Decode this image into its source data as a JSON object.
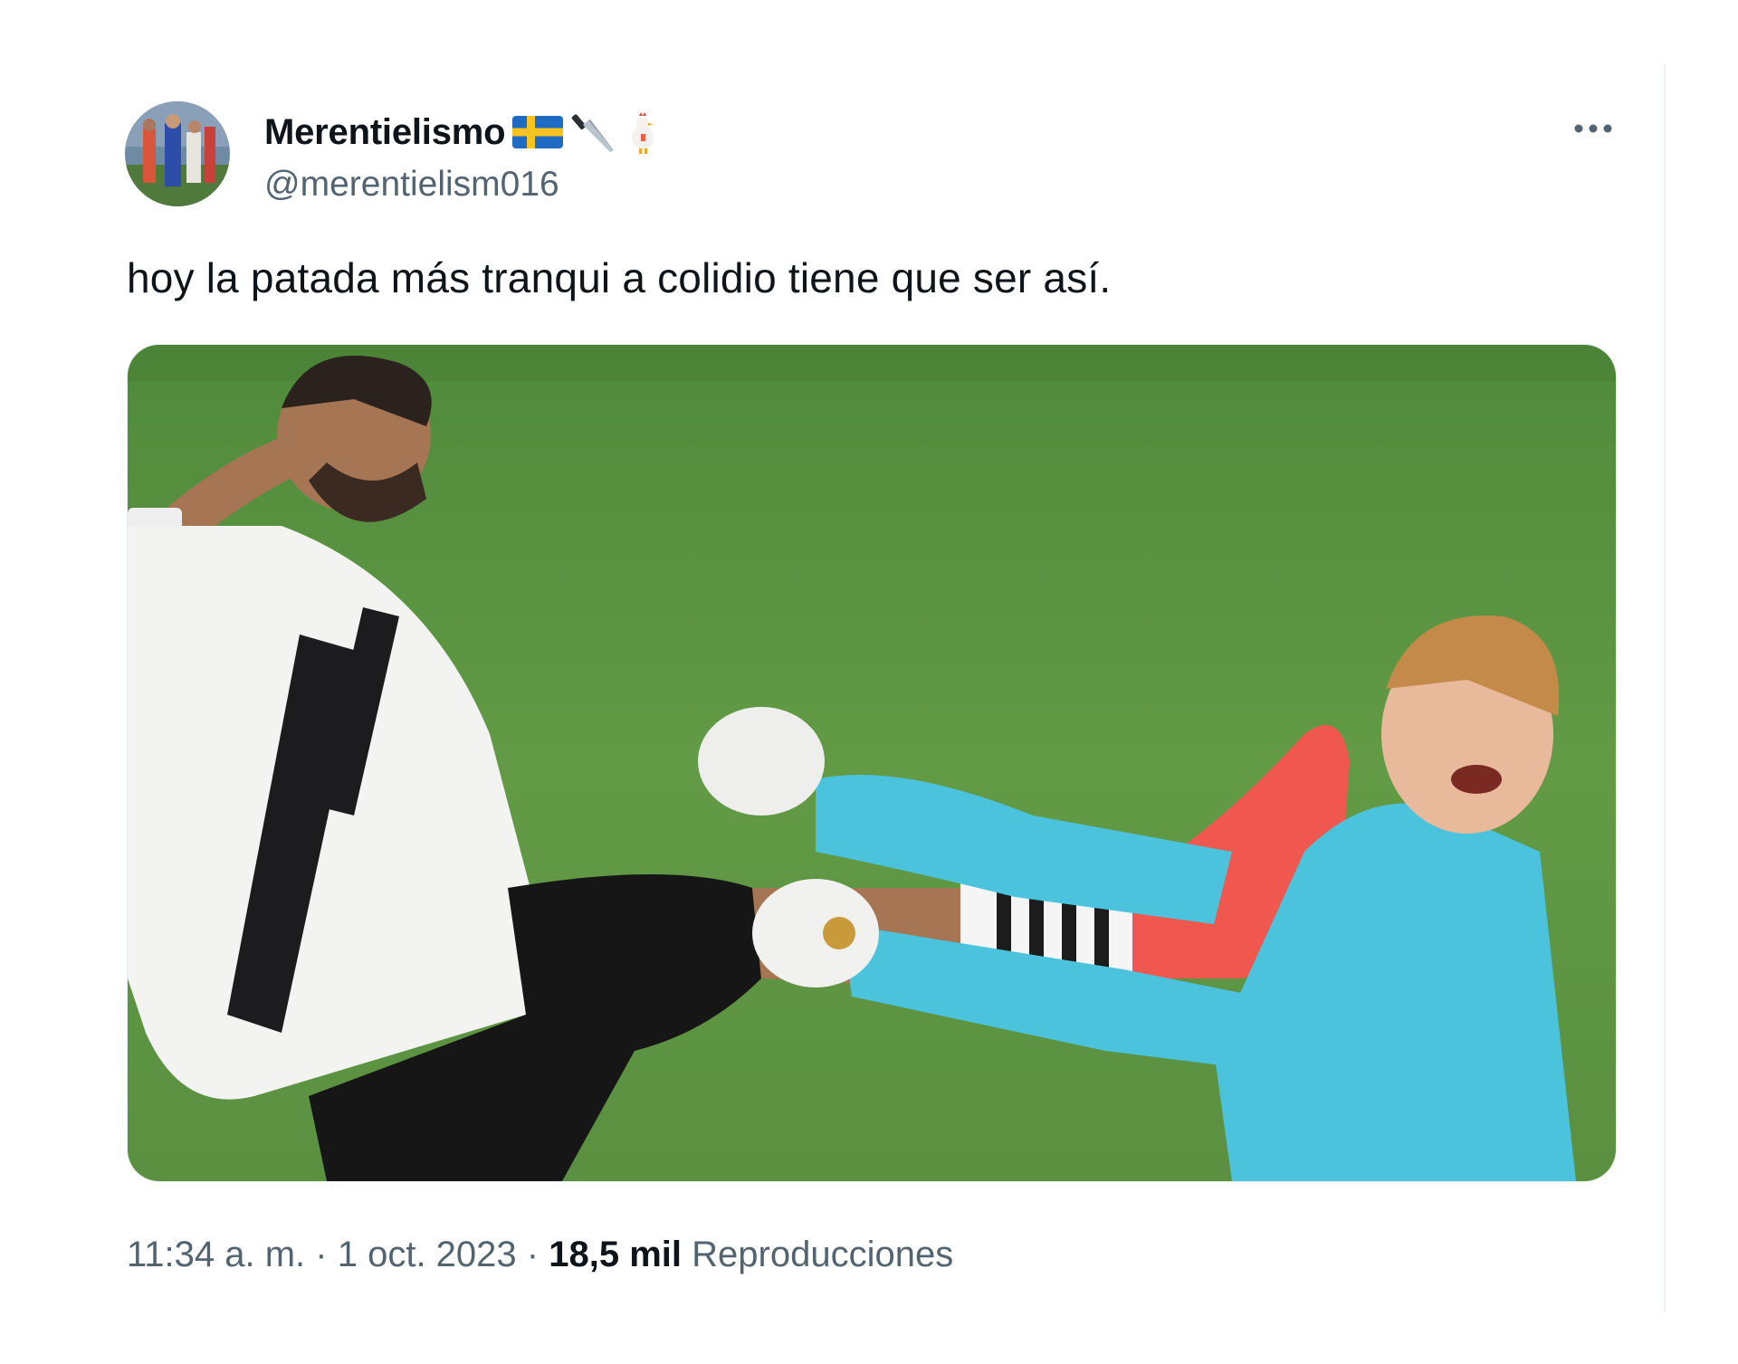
{
  "tweet": {
    "display_name": "Merentielismo",
    "name_emojis": [
      "sweden-flag-icon",
      "knife-icon",
      "chicken-icon"
    ],
    "handle": "@merentielism016",
    "text": "hoy la patada más tranqui a colidio tiene que ser así.",
    "more_icon": "more-dots-icon",
    "time": "11:34 a. m.",
    "separator": "·",
    "date": "1 oct. 2023",
    "views_count": "18,5 mil",
    "views_label": "Reproducciones"
  },
  "colors": {
    "text_primary": "#0f1419",
    "text_secondary": "#536471",
    "pitch_green": "#5c8f3f",
    "keeper_blue": "#4cc3dc",
    "boot_coral": "#f0574f"
  }
}
